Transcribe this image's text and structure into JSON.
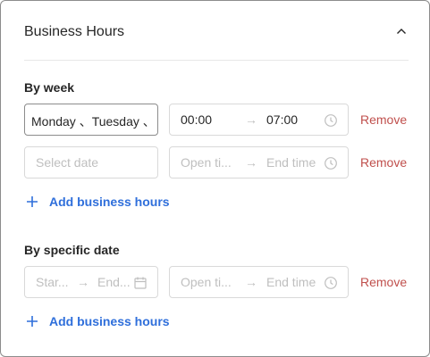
{
  "header": {
    "title": "Business Hours",
    "collapse_icon": "chevron-up-icon"
  },
  "by_week": {
    "title": "By week",
    "rows": [
      {
        "days": "Monday 、Tuesday 、",
        "open_time": "00:00",
        "close_time": "07:00",
        "remove_label": "Remove"
      },
      {
        "date_placeholder": "Select date",
        "open_placeholder": "Open ti...",
        "end_placeholder": "End time",
        "remove_label": "Remove"
      }
    ],
    "add_label": "Add business hours"
  },
  "by_date": {
    "title": "By specific date",
    "start_placeholder": "Star...",
    "end_date_placeholder": "End...",
    "open_placeholder": "Open ti...",
    "end_placeholder": "End time",
    "remove_label": "Remove",
    "add_label": "Add business hours"
  },
  "colors": {
    "accent": "#2f6fdb",
    "danger": "#c0504d",
    "border": "#d9d9d9"
  }
}
